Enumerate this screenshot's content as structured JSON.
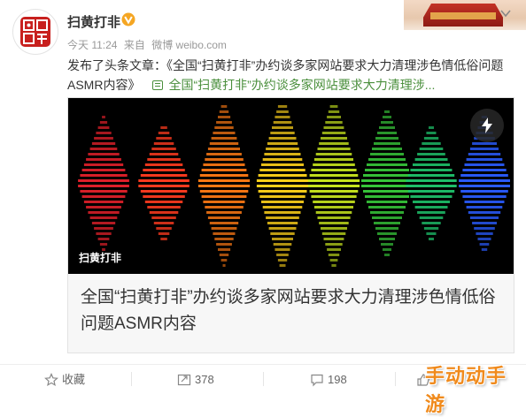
{
  "account": {
    "name": "扫黄打非",
    "avatar_icon": "red-seal-logo-icon",
    "verified_icon": "verified-badge-icon",
    "verified_color": "#f5a623"
  },
  "meta": {
    "time": "今天 11:24",
    "source_prefix": "来自",
    "source": "微博 weibo.com"
  },
  "post": {
    "text": "发布了头条文章：《全国“扫黄打非”办约谈多家网站要求大力清理涉色情低俗问题ASMR内容》",
    "link_icon": "article-link-icon",
    "link_text": "全国“扫黄打非”办约谈多家网站要求大力清理涉...",
    "link_color": "#4a8f3c"
  },
  "card": {
    "image_label": "扫黄打非",
    "flash_icon": "lightning-icon",
    "title": "全国“扫黄打非”办约谈多家网站要求大力清理涉色情低俗问题ASMR内容"
  },
  "actions": {
    "favorite": {
      "icon": "star-icon",
      "label": "收藏"
    },
    "repost": {
      "icon": "repost-icon",
      "count": "378"
    },
    "comment": {
      "icon": "comment-icon",
      "count": "198"
    },
    "like": {
      "icon": "thumbs-up-icon",
      "count": ""
    }
  },
  "watermark": "手动动手游",
  "colors": {
    "accent_red": "#c8201e",
    "text": "#333333",
    "muted": "#999999"
  }
}
